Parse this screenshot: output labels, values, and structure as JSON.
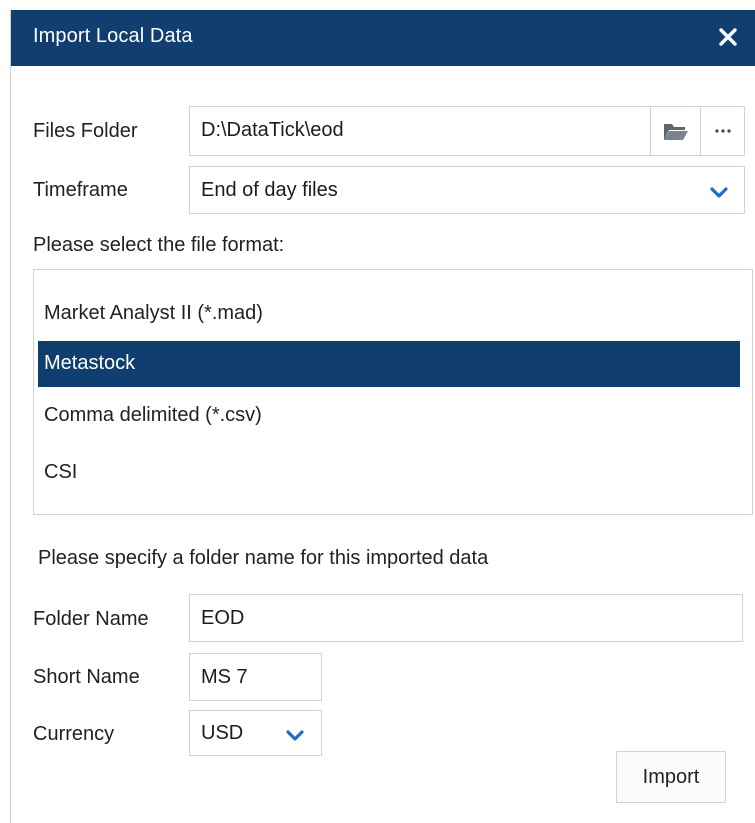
{
  "dialog": {
    "title": "Import Local Data",
    "close_icon": "close-icon"
  },
  "files_folder": {
    "label": "Files Folder",
    "value": "D:\\DataTick\\eod",
    "browse_icon": "folder-open-icon",
    "more_icon": "ellipsis-icon"
  },
  "timeframe": {
    "label": "Timeframe",
    "value": "End of day files",
    "dropdown_icon": "chevron-down-icon"
  },
  "file_format": {
    "prompt": "Please select the file format:",
    "items": [
      {
        "label": "Market Analyst II (*.mad)"
      },
      {
        "label": "Metastock"
      },
      {
        "label": "Comma delimited (*.csv)"
      },
      {
        "label": "CSI"
      }
    ],
    "selected": "Metastock"
  },
  "folder_prompt": "Please specify a folder name for this imported data",
  "folder_name": {
    "label": "Folder Name",
    "value": "EOD"
  },
  "short_name": {
    "label": "Short Name",
    "value": "MS 7"
  },
  "currency": {
    "label": "Currency",
    "value": "USD",
    "dropdown_icon": "chevron-down-icon"
  },
  "import_button": {
    "label": "Import"
  },
  "colors": {
    "titlebar": "#0f3e6f",
    "selection": "#0f3e6f",
    "chevron": "#1f6fc0",
    "border": "#cdd3da"
  }
}
